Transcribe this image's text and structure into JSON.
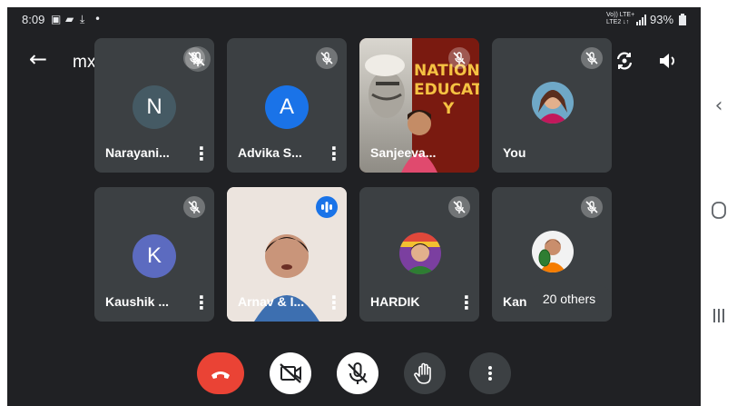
{
  "status_bar": {
    "time": "8:09",
    "network_label_top": "Vo)) LTE+",
    "network_label_bottom": "LTE2 ↓↑",
    "battery": "93%"
  },
  "header": {
    "meeting_code": "mxv-zxyx-vgj"
  },
  "participants": [
    {
      "name": "Narayani...",
      "initial": "N",
      "avatar_color": "#455a64",
      "muted": true
    },
    {
      "name": "Advika S...",
      "initial": "A",
      "avatar_color": "#1a73e8",
      "muted": true
    },
    {
      "name": "Sanjeeva...",
      "muted": true,
      "video": true,
      "poster_text": [
        "NATIONAL",
        "EDUCAT",
        "Y"
      ]
    },
    {
      "name": "You",
      "muted": true
    },
    {
      "name": "Kaushik ...",
      "initial": "K",
      "avatar_color": "#5c6bc0",
      "muted": true
    },
    {
      "name": "Arnav & I...",
      "speaking": true,
      "video": true
    },
    {
      "name": "HARDIK",
      "muted": true
    },
    {
      "name": "Kan",
      "muted": true
    }
  ],
  "others_pill": "20 others",
  "controls": {
    "end_call_color": "#ea4335"
  },
  "icons": [
    "back-arrow-icon",
    "mic-off-icon",
    "camera-switch-icon",
    "speaker-icon",
    "more-vert-icon",
    "end-call-icon",
    "camera-off-icon",
    "raise-hand-icon",
    "nav-back-icon",
    "nav-home-icon",
    "nav-recents-icon"
  ]
}
